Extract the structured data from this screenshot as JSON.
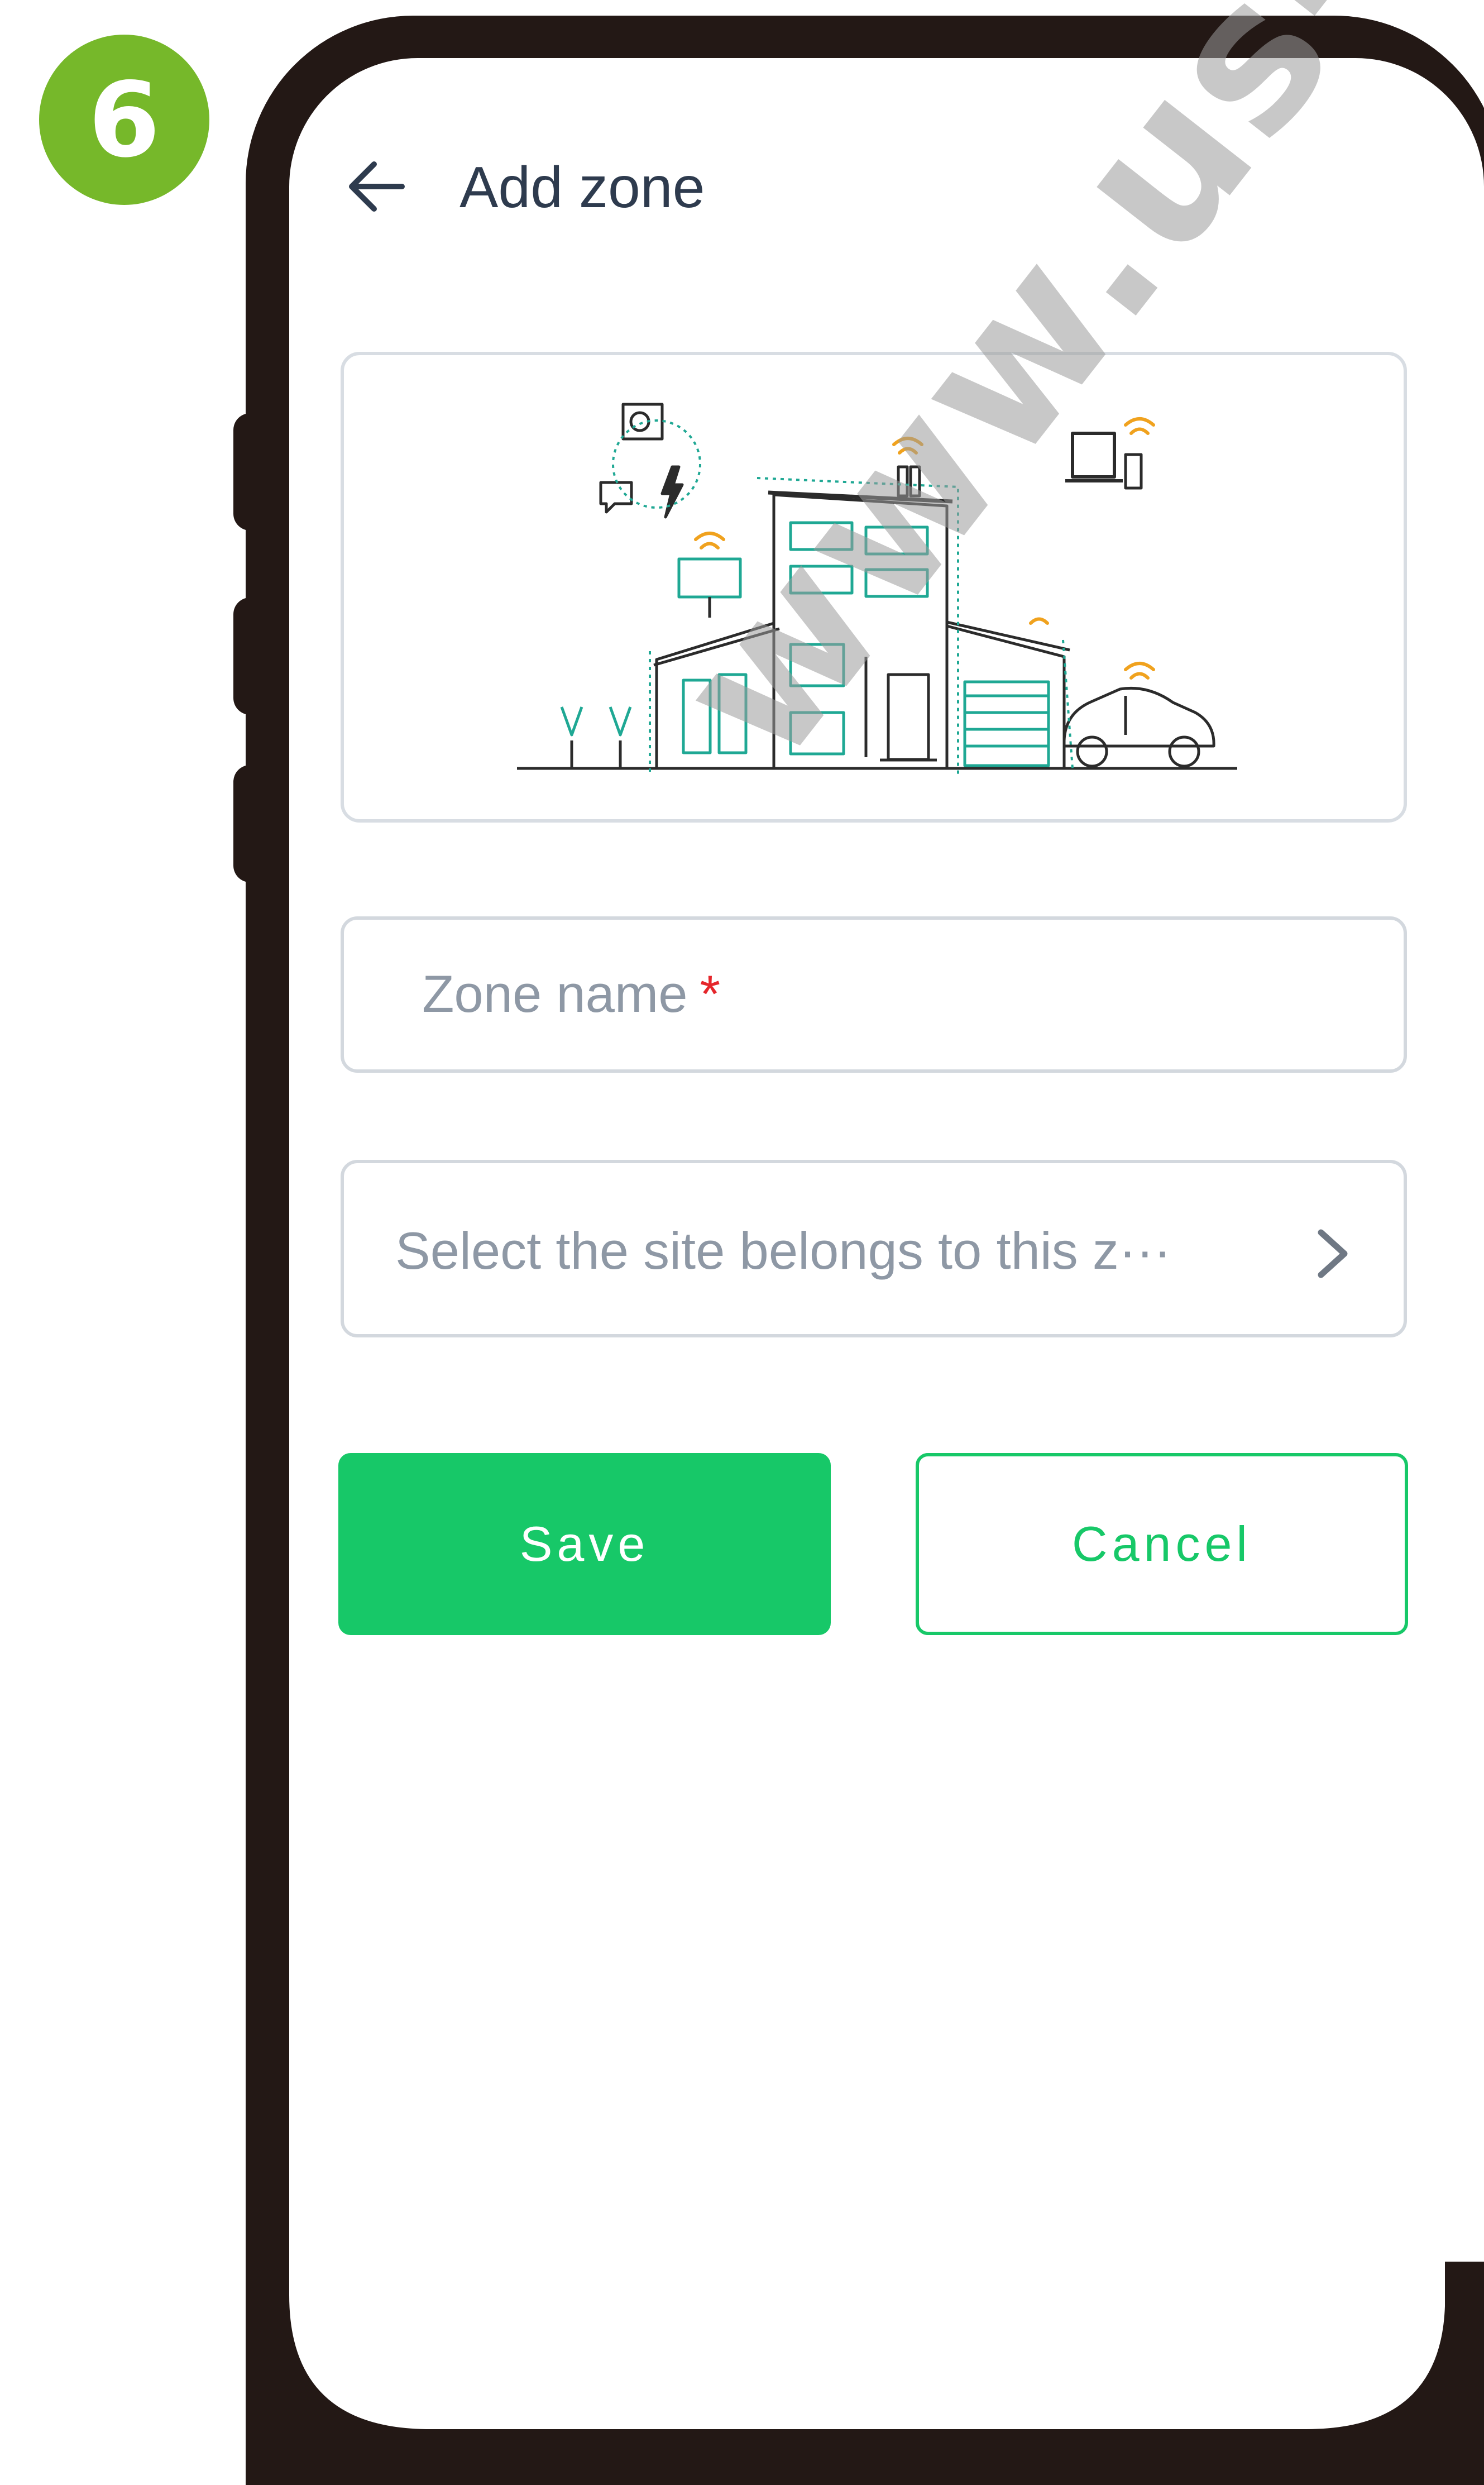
{
  "step_badge": "6",
  "header": {
    "title": "Add zone",
    "back_icon": "arrow-left-icon"
  },
  "illustration": {
    "icon": "smart-home-illustration"
  },
  "form": {
    "zone_name_placeholder": "Zone name",
    "zone_name_required_mark": "*",
    "site_select_placeholder": "Select the site belongs to this z···",
    "site_select_icon": "chevron-right-icon"
  },
  "buttons": {
    "save_label": "Save",
    "cancel_label": "Cancel"
  },
  "watermark": "www.us-r",
  "colors": {
    "accent_green": "#17c868",
    "badge_green": "#76b82a",
    "phone_frame": "#231815",
    "required_red": "#e5262b",
    "illustration_teal": "#1fa894",
    "illustration_orange": "#f0a21e"
  }
}
